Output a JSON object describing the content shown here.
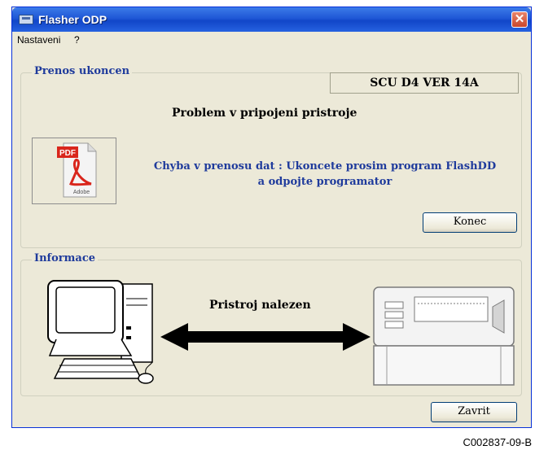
{
  "window": {
    "title": "Flasher ODP",
    "close_glyph": "✕"
  },
  "menu": {
    "items": [
      "Nastaveni",
      "?"
    ]
  },
  "transfer_group": {
    "title": "Prenos ukoncen",
    "version": "SCU D4 VER  14A",
    "problem": "Problem v pripojeni pristroje",
    "error_line1": "Chyba v prenosu dat : Ukoncete prosim program FlashDD",
    "error_line2": "a odpojte programator",
    "close_label": "Konec",
    "pdf_icon": {
      "badge": "PDF",
      "brand": "Adobe",
      "name": "pdf-icon"
    }
  },
  "info_group": {
    "title": "Informace",
    "status": "Pristroj nalezen"
  },
  "footer": {
    "close_label": "Zavrit"
  },
  "caption": "C002837-09-B",
  "colors": {
    "titlebar": "#1f57d6",
    "accent": "#1f3b9c",
    "window_bg": "#ece9d8"
  }
}
